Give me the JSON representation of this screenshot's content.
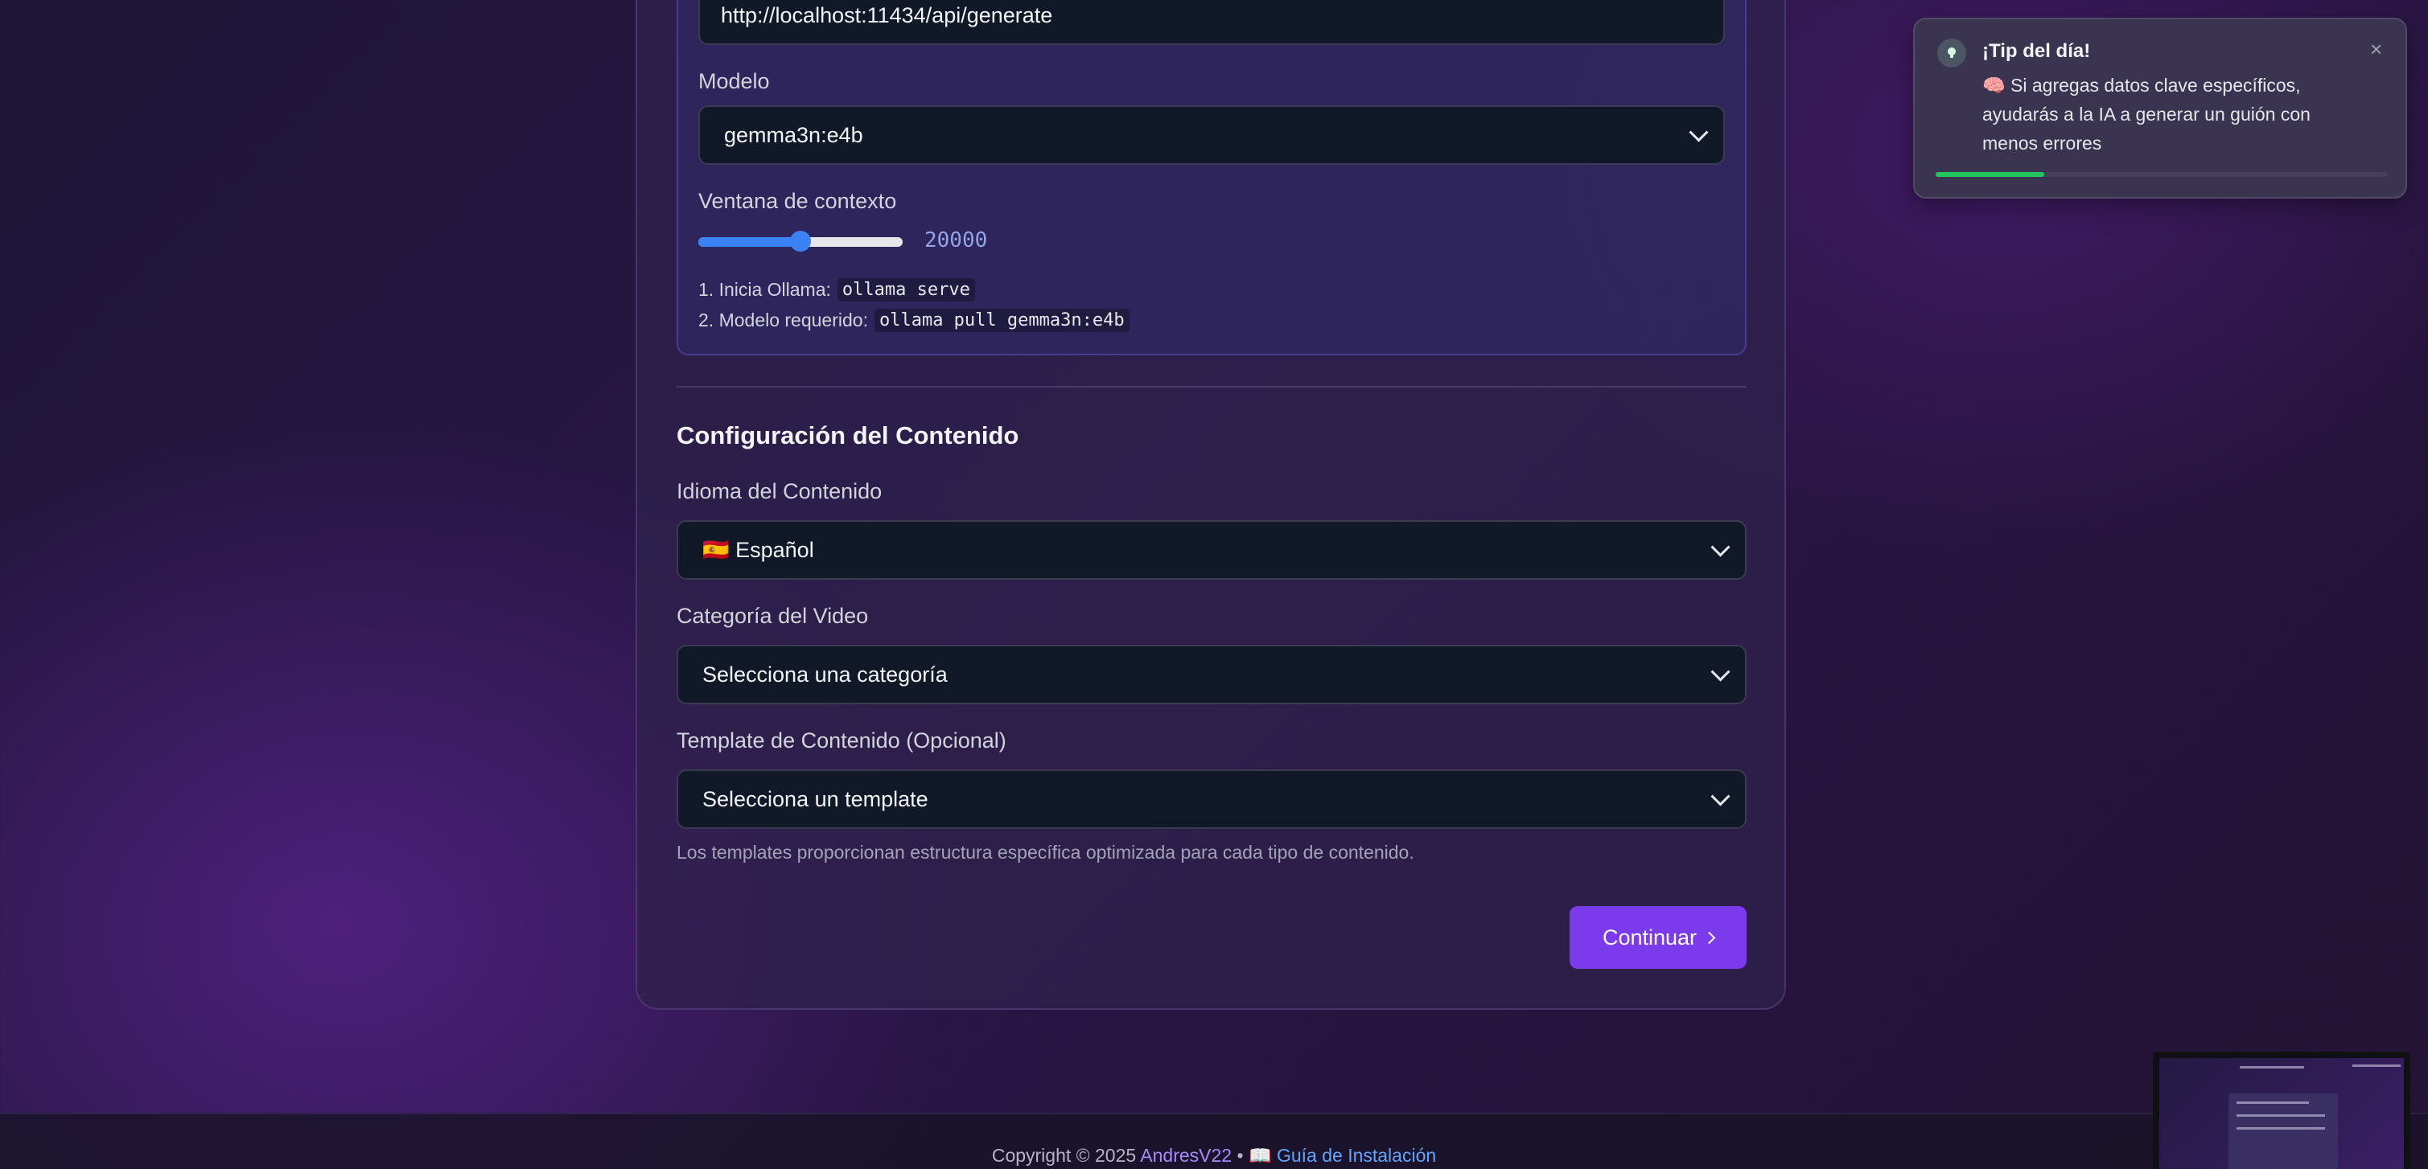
{
  "ollama": {
    "url_value": "http://localhost:11434/api/generate",
    "model_label": "Modelo",
    "model_value": "gemma3n:e4b",
    "context_label": "Ventana de contexto",
    "context_value": "20000",
    "context_fraction": 0.5,
    "step1_prefix": "1. Inicia Ollama:",
    "step1_code": "ollama serve",
    "step2_prefix": "2. Modelo requerido:",
    "step2_code": "ollama pull gemma3n:e4b"
  },
  "content": {
    "section_title": "Configuración del Contenido",
    "language_label": "Idioma del Contenido",
    "language_value": "🇪🇸 Español",
    "category_label": "Categoría del Video",
    "category_value": "Selecciona una categoría",
    "template_label": "Template de Contenido (Opcional)",
    "template_value": "Selecciona un template",
    "helper_text": "Los templates proporcionan estructura específica optimizada para cada tipo de contenido.",
    "continue_label": "Continuar"
  },
  "toast": {
    "title": "¡Tip del día!",
    "body": "🧠 Si agregas datos clave específicos, ayudarás a la IA a generar un guión con menos errores",
    "close": "×",
    "progress_fraction": 0.24
  },
  "footer": {
    "copyright": "Copyright © 2025",
    "author": "AndresV22",
    "separator": "•",
    "guide_icon": "📖",
    "guide_label": "Guía de Instalación"
  },
  "colors": {
    "accent": "#7c3aed",
    "slider": "#3b82f6",
    "progress": "#22c55e",
    "link": "#60a5fa",
    "author": "#a78bfa"
  },
  "icons": {
    "toast_icon": "lightbulb-icon",
    "close_icon": "close-icon",
    "select_chevron": "chevron-down-icon",
    "continue_chevron": "chevron-right-icon"
  }
}
